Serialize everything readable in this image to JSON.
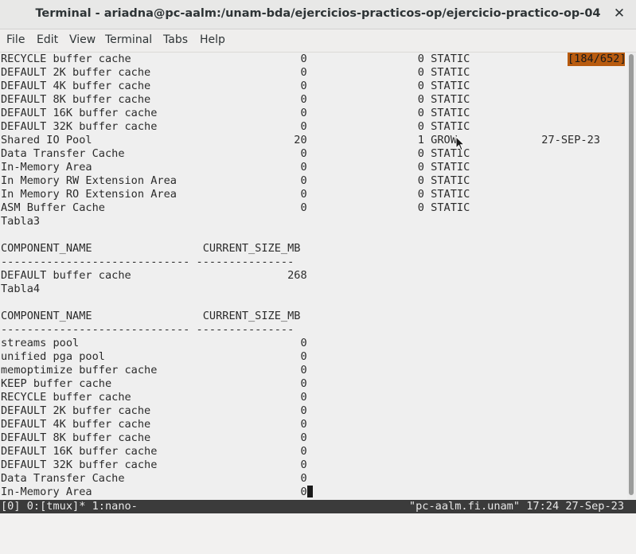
{
  "window": {
    "title": "Terminal - ariadna@pc-aalm:/unam-bda/ejercicios-practicos-op/ejercicio-practico-op-04",
    "close_glyph": "✕"
  },
  "menu": [
    "File",
    "Edit",
    "View",
    "Terminal",
    "Tabs",
    "Help"
  ],
  "badge": "[184/652]",
  "lines": [
    "RECYCLE buffer cache                          0                 0 STATIC",
    "DEFAULT 2K buffer cache                       0                 0 STATIC",
    "DEFAULT 4K buffer cache                       0                 0 STATIC",
    "DEFAULT 8K buffer cache                       0                 0 STATIC",
    "DEFAULT 16K buffer cache                      0                 0 STATIC",
    "DEFAULT 32K buffer cache                      0                 0 STATIC",
    "Shared IO Pool                               20                 1 GROW             27-SEP-23",
    "Data Transfer Cache                           0                 0 STATIC",
    "In-Memory Area                                0                 0 STATIC",
    "In Memory RW Extension Area                   0                 0 STATIC",
    "In Memory RO Extension Area                   0                 0 STATIC",
    "ASM Buffer Cache                              0                 0 STATIC",
    "Tabla3",
    "",
    "COMPONENT_NAME                 CURRENT_SIZE_MB",
    "----------------------------- ---------------",
    "DEFAULT buffer cache                        268",
    "Tabla4",
    "",
    "COMPONENT_NAME                 CURRENT_SIZE_MB",
    "----------------------------- ---------------",
    "streams pool                                  0",
    "unified pga pool                              0",
    "memoptimize buffer cache                      0",
    "KEEP buffer cache                             0",
    "RECYCLE buffer cache                          0",
    "DEFAULT 2K buffer cache                       0",
    "DEFAULT 4K buffer cache                       0",
    "DEFAULT 8K buffer cache                       0",
    "DEFAULT 16K buffer cache                      0",
    "DEFAULT 32K buffer cache                      0",
    "Data Transfer Cache                           0",
    "In-Memory Area                                0"
  ],
  "status": {
    "left": "[0] 0:[tmux]* 1:nano-",
    "right": "\"pc-aalm.fi.unam\" 17:24 27-Sep-23"
  }
}
